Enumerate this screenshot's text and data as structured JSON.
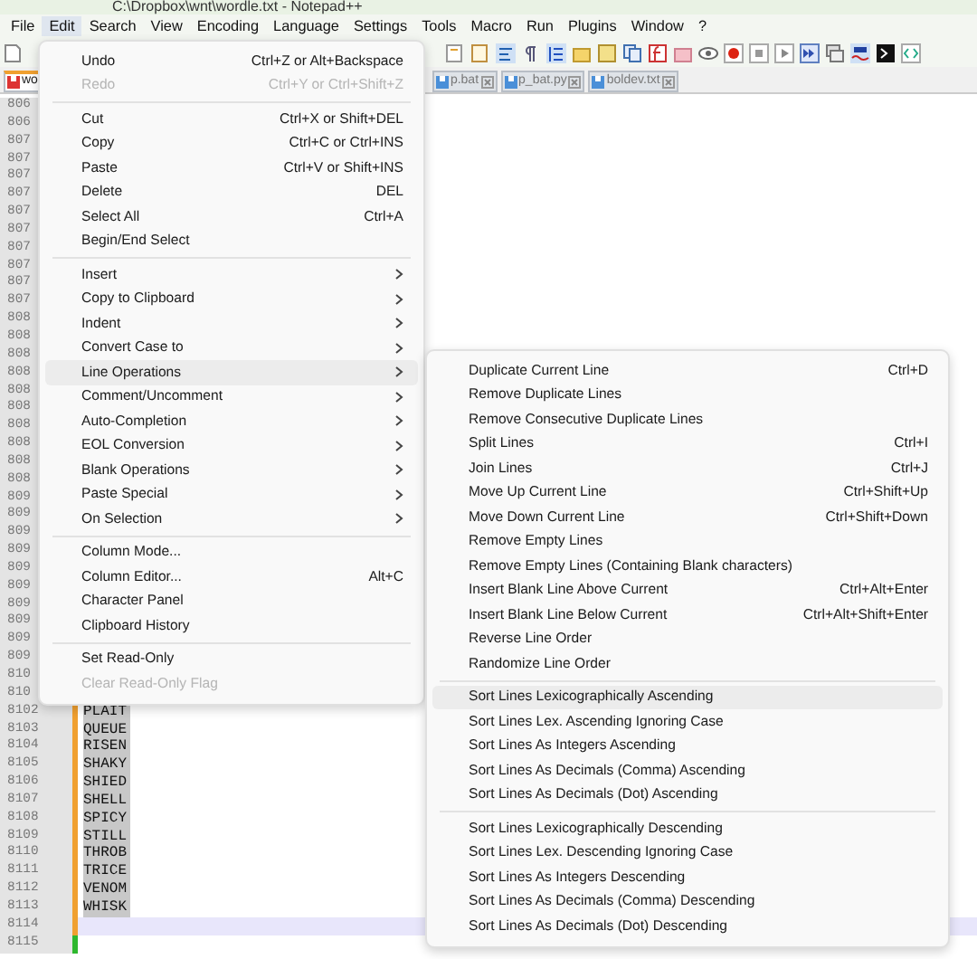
{
  "window": {
    "title": "C:\\Dropbox\\wnt\\wordle.txt - Notepad++"
  },
  "menu_bar": [
    {
      "label": "File",
      "selected": false
    },
    {
      "label": "Edit",
      "selected": true
    },
    {
      "label": "Search",
      "selected": false
    },
    {
      "label": "View",
      "selected": false
    },
    {
      "label": "Encoding",
      "selected": false
    },
    {
      "label": "Language",
      "selected": false
    },
    {
      "label": "Settings",
      "selected": false
    },
    {
      "label": "Tools",
      "selected": false
    },
    {
      "label": "Macro",
      "selected": false
    },
    {
      "label": "Run",
      "selected": false
    },
    {
      "label": "Plugins",
      "selected": false
    },
    {
      "label": "Window",
      "selected": false
    },
    {
      "label": "?",
      "selected": false
    }
  ],
  "tabs": [
    {
      "label": "wo",
      "selected": true
    },
    {
      "label": "p.bat",
      "selected": false
    },
    {
      "label": "p_bat.py",
      "selected": false
    },
    {
      "label": "boldev.txt",
      "selected": false
    }
  ],
  "editor": {
    "lines": [
      {
        "number": "806"
      },
      {
        "number": "806"
      },
      {
        "number": "807"
      },
      {
        "number": "807"
      },
      {
        "number": "807"
      },
      {
        "number": "807"
      },
      {
        "number": "807"
      },
      {
        "number": "807"
      },
      {
        "number": "807"
      },
      {
        "number": "807"
      },
      {
        "number": "807"
      },
      {
        "number": "807"
      },
      {
        "number": "808"
      },
      {
        "number": "808"
      },
      {
        "number": "808"
      },
      {
        "number": "808"
      },
      {
        "number": "808"
      },
      {
        "number": "808"
      },
      {
        "number": "808"
      },
      {
        "number": "808"
      },
      {
        "number": "808"
      },
      {
        "number": "808"
      },
      {
        "number": "809"
      },
      {
        "number": "809"
      },
      {
        "number": "809"
      },
      {
        "number": "809"
      },
      {
        "number": "809"
      },
      {
        "number": "809"
      },
      {
        "number": "809"
      },
      {
        "number": "809"
      },
      {
        "number": "809"
      },
      {
        "number": "809"
      },
      {
        "number": "810"
      },
      {
        "number": "810"
      },
      {
        "number": "8102",
        "text": "PLAIT",
        "selected": true,
        "saved": true
      },
      {
        "number": "8103",
        "text": "QUEUE",
        "selected": true,
        "saved": true
      },
      {
        "number": "8104",
        "text": "RISEN",
        "selected": true,
        "saved": true
      },
      {
        "number": "8105",
        "text": "SHAKY",
        "selected": true,
        "saved": true
      },
      {
        "number": "8106",
        "text": "SHIED",
        "selected": true,
        "saved": true
      },
      {
        "number": "8107",
        "text": "SHELL",
        "selected": true,
        "saved": true
      },
      {
        "number": "8108",
        "text": "SPICY",
        "selected": true,
        "saved": true
      },
      {
        "number": "8109",
        "text": "STILL",
        "selected": true,
        "saved": true
      },
      {
        "number": "8110",
        "text": "THROB",
        "selected": true,
        "saved": true
      },
      {
        "number": "8111",
        "text": "TRICE",
        "selected": true,
        "saved": true
      },
      {
        "number": "8112",
        "text": "VENOM",
        "selected": true,
        "saved": true
      },
      {
        "number": "8113",
        "text": "WHISK",
        "selected": true,
        "saved": true
      },
      {
        "number": "8114",
        "current": true,
        "saved": true
      },
      {
        "number": "8115",
        "saved": false
      }
    ]
  },
  "edit_menu": [
    {
      "kind": "item",
      "label": "Undo",
      "shortcut": "Ctrl+Z or Alt+Backspace",
      "disabled": false,
      "submenu": false,
      "selected": false
    },
    {
      "kind": "item",
      "label": "Redo",
      "shortcut": "Ctrl+Y or Ctrl+Shift+Z",
      "disabled": true,
      "submenu": false,
      "selected": false
    },
    {
      "kind": "separator"
    },
    {
      "kind": "item",
      "label": "Cut",
      "shortcut": "Ctrl+X or Shift+DEL",
      "disabled": false,
      "submenu": false,
      "selected": false
    },
    {
      "kind": "item",
      "label": "Copy",
      "shortcut": "Ctrl+C or Ctrl+INS",
      "disabled": false,
      "submenu": false,
      "selected": false
    },
    {
      "kind": "item",
      "label": "Paste",
      "shortcut": "Ctrl+V or Shift+INS",
      "disabled": false,
      "submenu": false,
      "selected": false
    },
    {
      "kind": "item",
      "label": "Delete",
      "shortcut": "DEL",
      "disabled": false,
      "submenu": false,
      "selected": false
    },
    {
      "kind": "item",
      "label": "Select All",
      "shortcut": "Ctrl+A",
      "disabled": false,
      "submenu": false,
      "selected": false
    },
    {
      "kind": "item",
      "label": "Begin/End Select",
      "disabled": false,
      "submenu": false,
      "selected": false
    },
    {
      "kind": "separator"
    },
    {
      "kind": "item",
      "label": "Insert",
      "disabled": false,
      "submenu": true,
      "selected": false
    },
    {
      "kind": "item",
      "label": "Copy to Clipboard",
      "disabled": false,
      "submenu": true,
      "selected": false
    },
    {
      "kind": "item",
      "label": "Indent",
      "disabled": false,
      "submenu": true,
      "selected": false
    },
    {
      "kind": "item",
      "label": "Convert Case to",
      "disabled": false,
      "submenu": true,
      "selected": false
    },
    {
      "kind": "item",
      "label": "Line Operations",
      "disabled": false,
      "submenu": true,
      "selected": true
    },
    {
      "kind": "item",
      "label": "Comment/Uncomment",
      "disabled": false,
      "submenu": true,
      "selected": false
    },
    {
      "kind": "item",
      "label": "Auto-Completion",
      "disabled": false,
      "submenu": true,
      "selected": false
    },
    {
      "kind": "item",
      "label": "EOL Conversion",
      "disabled": false,
      "submenu": true,
      "selected": false
    },
    {
      "kind": "item",
      "label": "Blank Operations",
      "disabled": false,
      "submenu": true,
      "selected": false
    },
    {
      "kind": "item",
      "label": "Paste Special",
      "disabled": false,
      "submenu": true,
      "selected": false
    },
    {
      "kind": "item",
      "label": "On Selection",
      "disabled": false,
      "submenu": true,
      "selected": false
    },
    {
      "kind": "separator"
    },
    {
      "kind": "item",
      "label": "Column Mode...",
      "disabled": false,
      "submenu": false,
      "selected": false
    },
    {
      "kind": "item",
      "label": "Column Editor...",
      "shortcut": "Alt+C",
      "disabled": false,
      "submenu": false,
      "selected": false
    },
    {
      "kind": "item",
      "label": "Character Panel",
      "disabled": false,
      "submenu": false,
      "selected": false
    },
    {
      "kind": "item",
      "label": "Clipboard History",
      "disabled": false,
      "submenu": false,
      "selected": false
    },
    {
      "kind": "separator"
    },
    {
      "kind": "item",
      "label": "Set Read-Only",
      "disabled": false,
      "submenu": false,
      "selected": false
    },
    {
      "kind": "item",
      "label": "Clear Read-Only Flag",
      "disabled": true,
      "submenu": false,
      "selected": false
    }
  ],
  "line_operations_menu": [
    {
      "kind": "item",
      "label": "Duplicate Current Line",
      "shortcut": "Ctrl+D",
      "selected": false
    },
    {
      "kind": "item",
      "label": "Remove Duplicate Lines",
      "selected": false
    },
    {
      "kind": "item",
      "label": "Remove Consecutive Duplicate Lines",
      "selected": false
    },
    {
      "kind": "item",
      "label": "Split Lines",
      "shortcut": "Ctrl+I",
      "selected": false
    },
    {
      "kind": "item",
      "label": "Join Lines",
      "shortcut": "Ctrl+J",
      "selected": false
    },
    {
      "kind": "item",
      "label": "Move Up Current Line",
      "shortcut": "Ctrl+Shift+Up",
      "selected": false
    },
    {
      "kind": "item",
      "label": "Move Down Current Line",
      "shortcut": "Ctrl+Shift+Down",
      "selected": false
    },
    {
      "kind": "item",
      "label": "Remove Empty Lines",
      "selected": false
    },
    {
      "kind": "item",
      "label": "Remove Empty Lines (Containing Blank characters)",
      "selected": false
    },
    {
      "kind": "item",
      "label": "Insert Blank Line Above Current",
      "shortcut": "Ctrl+Alt+Enter",
      "selected": false
    },
    {
      "kind": "item",
      "label": "Insert Blank Line Below Current",
      "shortcut": "Ctrl+Alt+Shift+Enter",
      "selected": false
    },
    {
      "kind": "item",
      "label": "Reverse Line Order",
      "selected": false
    },
    {
      "kind": "item",
      "label": "Randomize Line Order",
      "selected": false
    },
    {
      "kind": "separator"
    },
    {
      "kind": "item",
      "label": "Sort Lines Lexicographically Ascending",
      "selected": true
    },
    {
      "kind": "item",
      "label": "Sort Lines Lex. Ascending Ignoring Case",
      "selected": false
    },
    {
      "kind": "item",
      "label": "Sort Lines As Integers Ascending",
      "selected": false
    },
    {
      "kind": "item",
      "label": "Sort Lines As Decimals (Comma) Ascending",
      "selected": false
    },
    {
      "kind": "item",
      "label": "Sort Lines As Decimals (Dot) Ascending",
      "selected": false
    },
    {
      "kind": "separator"
    },
    {
      "kind": "item",
      "label": "Sort Lines Lexicographically Descending",
      "selected": false
    },
    {
      "kind": "item",
      "label": "Sort Lines Lex. Descending Ignoring Case",
      "selected": false
    },
    {
      "kind": "item",
      "label": "Sort Lines As Integers Descending",
      "selected": false
    },
    {
      "kind": "item",
      "label": "Sort Lines As Decimals (Comma) Descending",
      "selected": false
    },
    {
      "kind": "item",
      "label": "Sort Lines As Decimals (Dot) Descending",
      "selected": false
    }
  ]
}
